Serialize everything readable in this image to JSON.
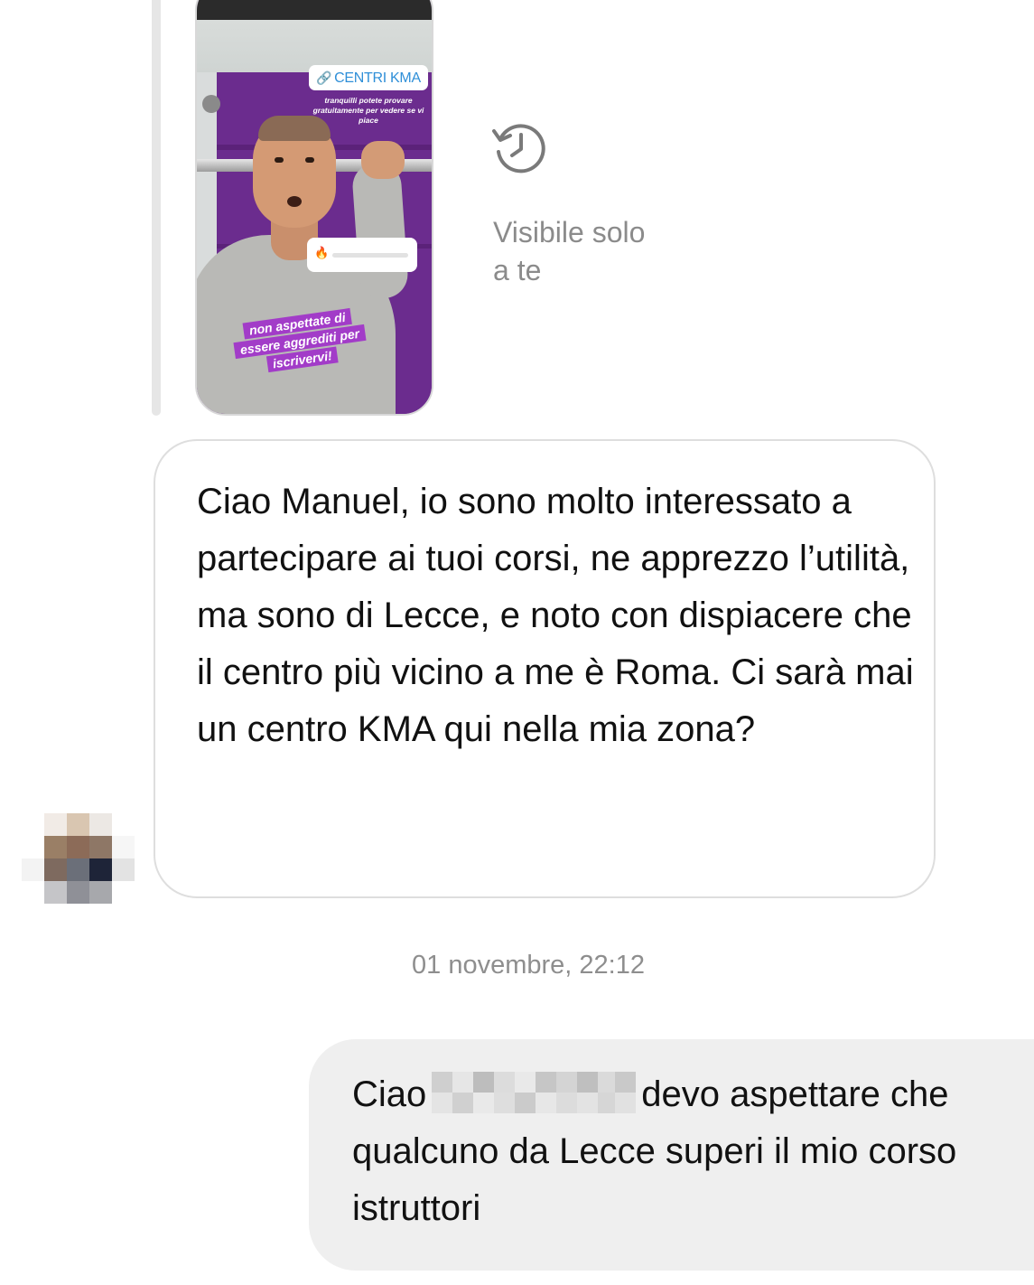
{
  "story": {
    "link_sticker": "CENTRI KMA",
    "small_caption": "tranquilli potete provare gratuitamente per vedere se vi piace",
    "caption_lines": [
      "non aspettate di",
      "essere aggrediti per",
      "iscrivervi!"
    ]
  },
  "story_visibility": {
    "icon": "history-icon",
    "text": "Visibile solo\na te"
  },
  "incoming_message": {
    "text": "Ciao Manuel, io sono molto interessato a partecipare ai tuoi corsi, ne apprezzo l’utilità, ma sono di Lecce, e noto con dispiacere che il centro più vicino a me è Roma. Ci sarà mai un centro KMA qui nella mia zona?"
  },
  "timestamp": "01 novembre, 22:12",
  "outgoing_message": {
    "greeting": "Ciao",
    "text_after_name": "devo aspettare che qualcuno da Lecce superi il mio corso istruttori"
  },
  "colors": {
    "incoming_border": "#dedede",
    "outgoing_background": "#efefef",
    "muted_text": "#8b8b8b",
    "link_blue": "#2f8fd8",
    "story_purple": "#6b2c8e"
  }
}
